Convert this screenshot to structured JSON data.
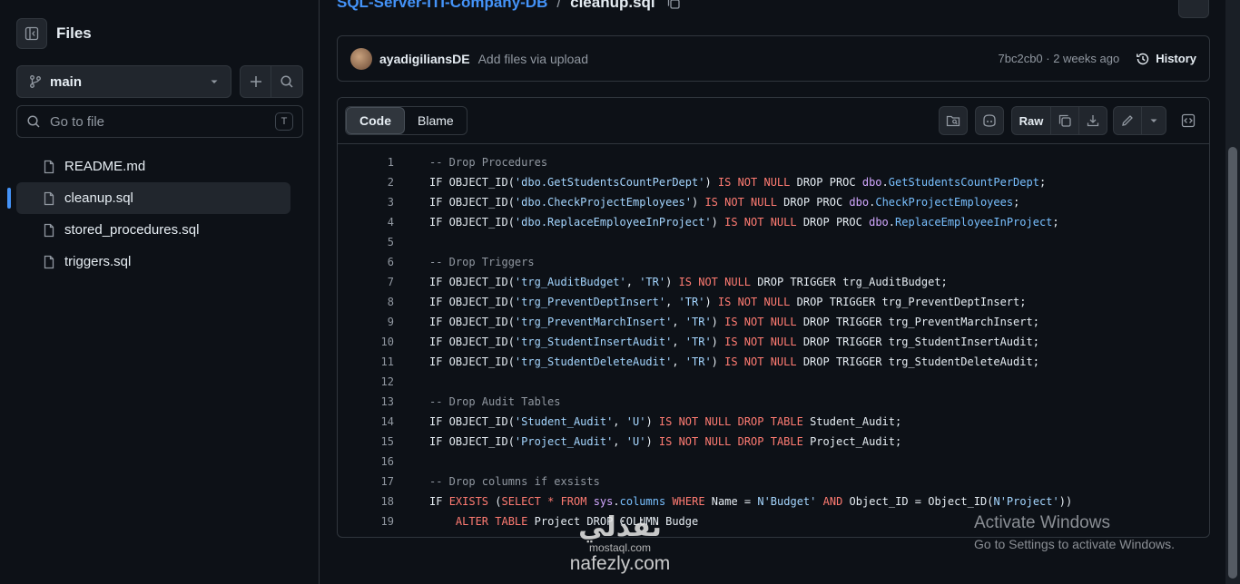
{
  "sidebar": {
    "title": "Files",
    "branch": "main",
    "goto_placeholder": "Go to file",
    "goto_shortcut": "T",
    "files": [
      {
        "name": "README.md",
        "active": false
      },
      {
        "name": "cleanup.sql",
        "active": true
      },
      {
        "name": "stored_procedures.sql",
        "active": false
      },
      {
        "name": "triggers.sql",
        "active": false
      }
    ]
  },
  "breadcrumb": {
    "repo": "SQL-Server-ITI-Company-DB",
    "separator": "/",
    "file": "cleanup.sql"
  },
  "commit": {
    "author": "ayadigiliansDE",
    "message": "Add files via upload",
    "meta": "7bc2cb0 · 2 weeks ago",
    "history_label": "History"
  },
  "file_header": {
    "tab_code": "Code",
    "tab_blame": "Blame",
    "raw_label": "Raw"
  },
  "code_lines": [
    "1",
    "2",
    "3",
    "4",
    "5",
    "6",
    "7",
    "8",
    "9",
    "10",
    "11",
    "12",
    "13",
    "14",
    "15",
    "16",
    "17",
    "18",
    "19"
  ],
  "code_text": [
    "-- Drop Procedures",
    "IF OBJECT_ID('dbo.GetStudentsCountPerDept') IS NOT NULL DROP PROC dbo.GetStudentsCountPerDept;",
    "IF OBJECT_ID('dbo.CheckProjectEmployees') IS NOT NULL DROP PROC dbo.CheckProjectEmployees;",
    "IF OBJECT_ID('dbo.ReplaceEmployeeInProject') IS NOT NULL DROP PROC dbo.ReplaceEmployeeInProject;",
    "",
    "-- Drop Triggers",
    "IF OBJECT_ID('trg_AuditBudget', 'TR') IS NOT NULL DROP TRIGGER trg_AuditBudget;",
    "IF OBJECT_ID('trg_PreventDeptInsert', 'TR') IS NOT NULL DROP TRIGGER trg_PreventDeptInsert;",
    "IF OBJECT_ID('trg_PreventMarchInsert', 'TR') IS NOT NULL DROP TRIGGER trg_PreventMarchInsert;",
    "IF OBJECT_ID('trg_StudentInsertAudit', 'TR') IS NOT NULL DROP TRIGGER trg_StudentInsertAudit;",
    "IF OBJECT_ID('trg_StudentDeleteAudit', 'TR') IS NOT NULL DROP TRIGGER trg_StudentDeleteAudit;",
    "",
    "-- Drop Audit Tables",
    "IF OBJECT_ID('Student_Audit', 'U') IS NOT NULL DROP TABLE Student_Audit;",
    "IF OBJECT_ID('Project_Audit', 'U') IS NOT NULL DROP TABLE Project_Audit;",
    "",
    "-- Drop columns if exsists",
    "IF EXISTS (SELECT * FROM sys.columns WHERE Name = N'Budget' AND Object_ID = Object_ID(N'Project'))",
    "    ALTER TABLE Project DROP COLUMN Budge"
  ],
  "watermark": {
    "line1": "Activate Windows",
    "line2": "Go to Settings to activate Windows."
  },
  "logo_watermark": {
    "arabic": "نفذلي",
    "small": "mostaql.com",
    "url": "nafezly.com"
  },
  "colors": {
    "accent": "#4493f8",
    "bg": "#0d1117",
    "border": "#30363d",
    "keyword": "#ff7b72",
    "string": "#a5d6ff",
    "function": "#d2a8ff"
  }
}
